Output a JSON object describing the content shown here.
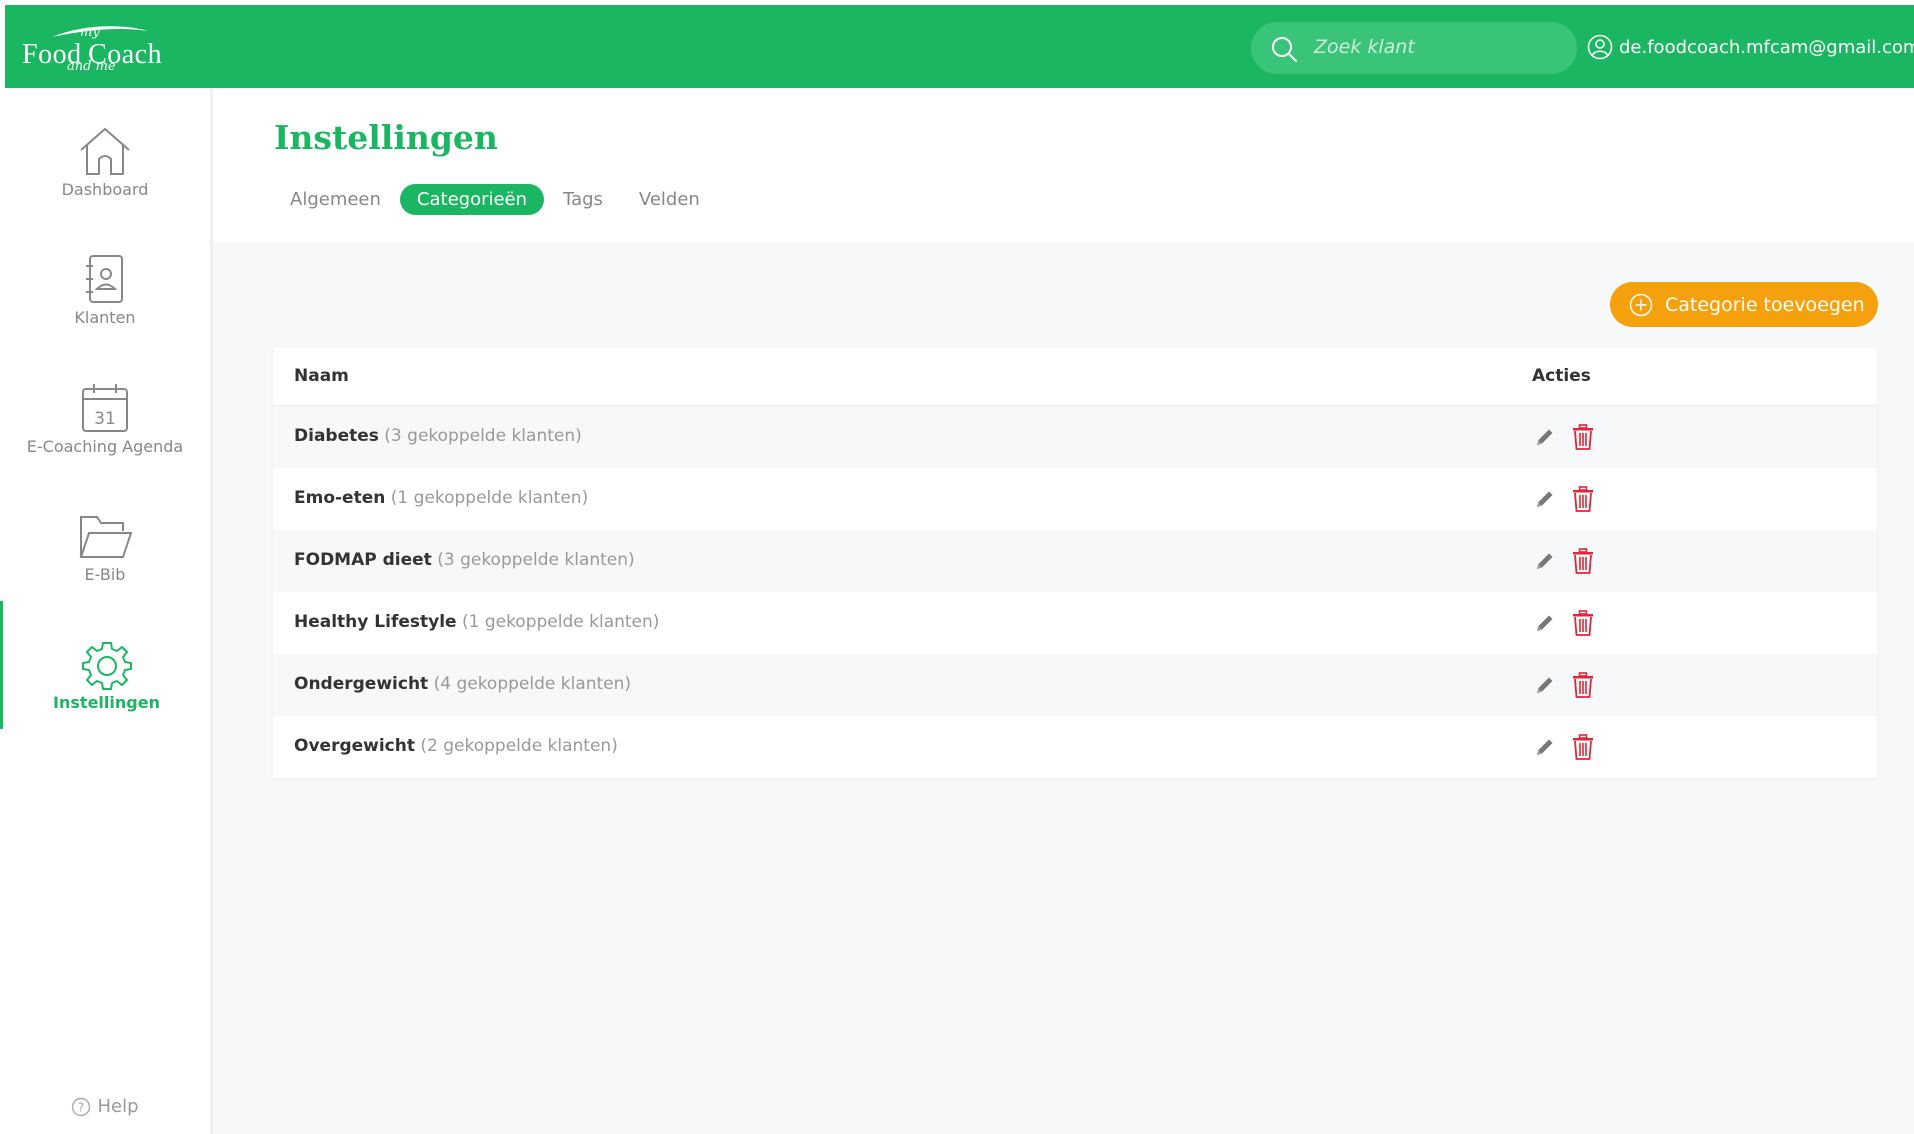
{
  "brand": {
    "logo_my": "my",
    "logo_food": "Food",
    "logo_coach": "Coach",
    "logo_and_me": "and me"
  },
  "header": {
    "search_placeholder": "Zoek klant",
    "user_email": "de.foodcoach.mfcam@gmail.com"
  },
  "sidebar": {
    "items": [
      {
        "label": "Dashboard",
        "icon": "home-icon"
      },
      {
        "label": "Klanten",
        "icon": "contacts-book-icon"
      },
      {
        "label": "E-Coaching Agenda",
        "icon": "calendar-icon",
        "day": "31"
      },
      {
        "label": "E-Bib",
        "icon": "folder-icon"
      },
      {
        "label": "Instellingen",
        "icon": "gear-icon",
        "active": true
      }
    ],
    "help_label": "Help"
  },
  "page": {
    "title": "Instellingen",
    "tabs": [
      "Algemeen",
      "Categorieën",
      "Tags",
      "Velden"
    ],
    "active_tab": "Categorieën"
  },
  "actions": {
    "add_category_label": "Categorie toevoegen"
  },
  "table": {
    "columns": [
      "Naam",
      "Acties"
    ],
    "rows": [
      {
        "name": "Diabetes",
        "count": "(3 gekoppelde klanten)"
      },
      {
        "name": "Emo-eten",
        "count": "(1 gekoppelde klanten)"
      },
      {
        "name": "FODMAP dieet",
        "count": "(3 gekoppelde klanten)"
      },
      {
        "name": "Healthy Lifestyle",
        "count": "(1 gekoppelde klanten)"
      },
      {
        "name": "Ondergewicht",
        "count": "(4 gekoppelde klanten)"
      },
      {
        "name": "Overgewicht",
        "count": "(2 gekoppelde klanten)"
      }
    ]
  },
  "colors": {
    "brand_green": "#1bb661",
    "accent_orange": "#f5a10d",
    "delete_red": "#e0263a"
  }
}
